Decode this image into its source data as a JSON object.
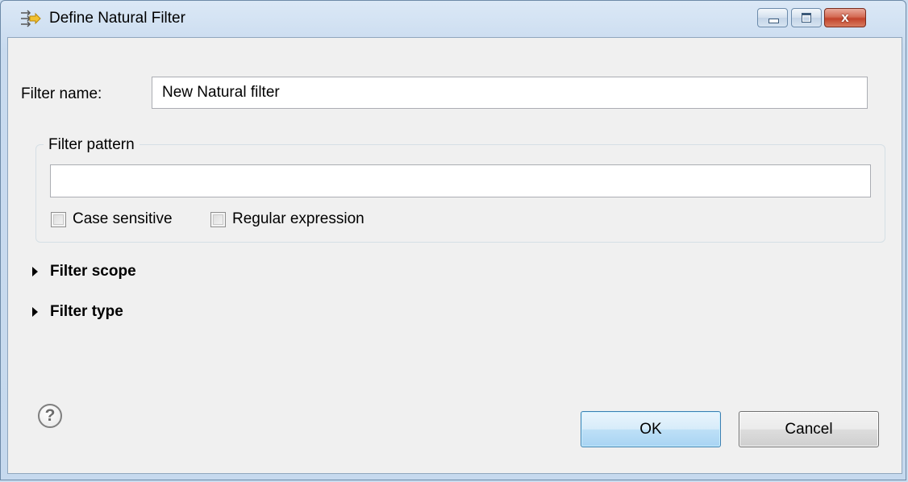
{
  "window": {
    "title": "Define Natural Filter",
    "icon": "filter-arrows-icon",
    "controls": {
      "minimize": "minimize-icon",
      "maximize": "maximize-icon",
      "close": "x"
    }
  },
  "form": {
    "filter_name_label": "Filter name:",
    "filter_name_value": "New Natural filter",
    "pattern_group_label": "Filter pattern",
    "pattern_value": "",
    "case_sensitive_label": "Case sensitive",
    "case_sensitive_checked": false,
    "regex_label": "Regular expression",
    "regex_checked": false
  },
  "sections": {
    "scope_label": "Filter scope",
    "type_label": "Filter type",
    "expanded": false
  },
  "footer": {
    "help_glyph": "?",
    "ok_label": "OK",
    "cancel_label": "Cancel"
  },
  "colors": {
    "accent": "#3c7fb1",
    "titlebar": "#c9dbef",
    "close": "#c2432b"
  }
}
